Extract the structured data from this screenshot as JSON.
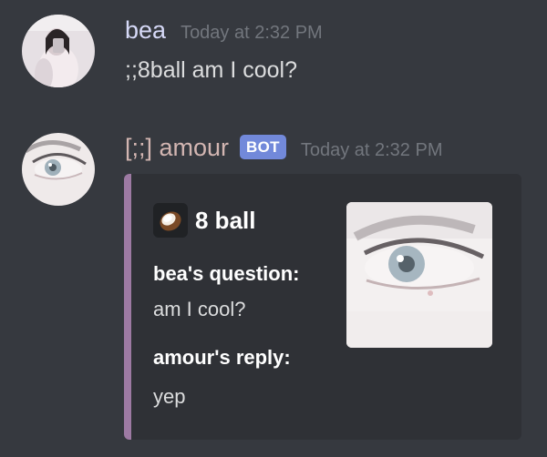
{
  "messages": [
    {
      "username": "bea",
      "username_color": "#d6d9f7",
      "timestamp": "Today at 2:32 PM",
      "content": ";;8ball am I cool?"
    },
    {
      "username": "[;;] amour",
      "username_color": "#d3b6b2",
      "bot_tag": "BOT",
      "timestamp": "Today at 2:32 PM",
      "embed": {
        "accent_color": "#9d7aa3",
        "author_icon": "coconut-icon",
        "author": "8 ball",
        "fields": [
          {
            "name": "bea's question:",
            "value": "am I cool?"
          },
          {
            "name": "amour's reply:",
            "value": "yep"
          }
        ],
        "thumbnail": "eye-image"
      }
    }
  ]
}
